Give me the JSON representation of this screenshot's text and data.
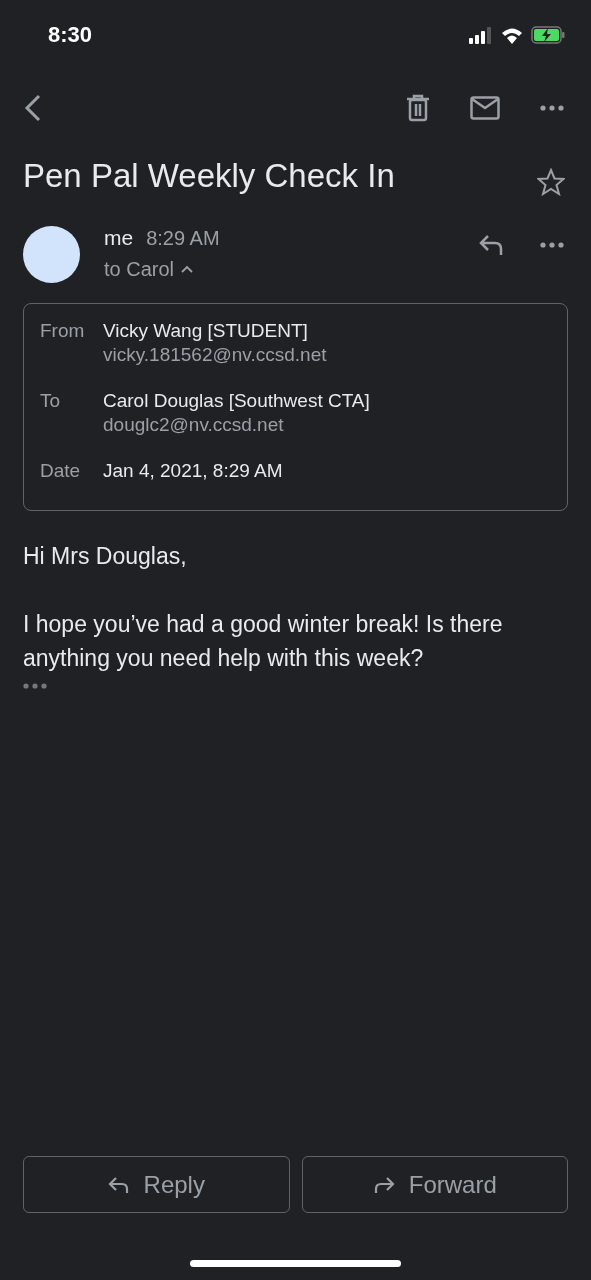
{
  "status_bar": {
    "time": "8:30"
  },
  "subject": "Pen Pal Weekly Check In",
  "starred": false,
  "message": {
    "sender": "me",
    "time": "8:29 AM",
    "recipient_summary": "to Carol",
    "details_expanded": true,
    "details": [
      {
        "label": "From",
        "name": "Vicky Wang [STUDENT]",
        "address": "vicky.181562@nv.ccsd.net"
      },
      {
        "label": "To",
        "name": "Carol Douglas [Southwest CTA]",
        "address": "douglc2@nv.ccsd.net"
      },
      {
        "label": "Date",
        "name": "Jan 4, 2021, 8:29 AM"
      }
    ],
    "body": [
      "Hi Mrs Douglas,",
      "I hope you’ve had a good winter break! Is there anything you need help with this week?"
    ]
  },
  "actions": [
    {
      "label": "Reply",
      "kind": "reply"
    },
    {
      "label": "Forward",
      "kind": "forward"
    }
  ]
}
